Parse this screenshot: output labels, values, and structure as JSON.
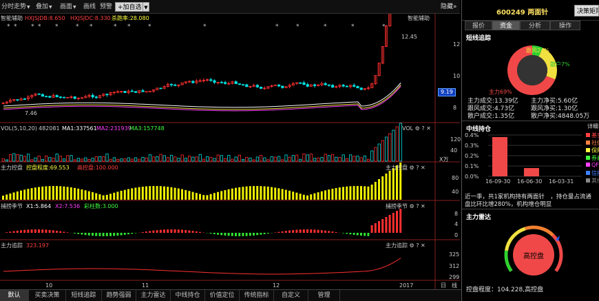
{
  "toolbar": {
    "items": [
      {
        "label": "分时走势",
        "has_arrow": true
      },
      {
        "label": "叠加",
        "has_arrow": true
      },
      {
        "label": "画面",
        "has_arrow": true
      },
      {
        "label": "画线",
        "has_arrow": false
      },
      {
        "label": "预警",
        "has_arrow": false
      },
      {
        "label": "+加自选",
        "has_arrow": false
      }
    ],
    "hide_label": "隐藏",
    "hide_arrow": "»"
  },
  "panels": {
    "main": {
      "title": "智能辅助",
      "title_right": "智能辅助",
      "ind1": "HXJSJDB:8.650",
      "ind2": "HXJSJDC:8.330",
      "ind3": "杀跑率:28.080",
      "price_high": "12.45",
      "price_low": "7.46",
      "current_price": "9.19",
      "axis": [
        "12",
        "10",
        "8"
      ]
    },
    "vol": {
      "title": "VOL(5,10,20)",
      "vol": "482081",
      "ma1": "MA1:337561",
      "ma2": "MA2:231939",
      "ma3": "MA3:157748",
      "title_right": "VOL",
      "axis": [
        "120",
        "40"
      ],
      "unit": "X万"
    },
    "ctrl": {
      "title": "主力控盘",
      "degree": "控盘程度:69.553",
      "high": "高控盘:100.000",
      "title_right": "主力控盘",
      "axis": [
        "80",
        "40"
      ]
    },
    "catch": {
      "title": "捕捞季节",
      "x1": "X1:5.864",
      "x2": "X2:7.536",
      "color": "彩柱数:3.000",
      "title_right": "捕捞季节",
      "axis": [
        "8",
        "4",
        "0"
      ]
    },
    "track": {
      "title": "主力追踪",
      "val": "323.197",
      "title_right": "主力追踪",
      "axis": [
        "325",
        "312",
        "299"
      ]
    },
    "xaxis": [
      "10",
      "11",
      "12",
      "2017"
    ],
    "corner": [
      "日",
      "线"
    ]
  },
  "bottom_tabs": [
    "默认",
    "买卖决策",
    "短线追踪",
    "趋势强弱",
    "主力雷达",
    "中线持仓",
    "价值定位",
    "传统指标",
    "自定义",
    "管理"
  ],
  "right": {
    "code": "600249",
    "name": "两面针",
    "stock_title": "600249 两面针",
    "decision_btn": "决策矩阵",
    "tabs": [
      "报价",
      "资金",
      "分析",
      "操作"
    ],
    "short_track": {
      "title": "短线追踪",
      "pie": {
        "zl": "主力69%",
        "gf": "跟风24%",
        "sh": "散户7%",
        "zl_v": 69,
        "gf_v": 24,
        "sh_v": 7,
        "zl_color": "#f04848",
        "gf_color": "#f0e040",
        "sh_color": "#30d030"
      },
      "rows": [
        [
          "主力成交:13.39亿",
          "主力净买:5.60亿"
        ],
        [
          "跟风成交:4.73亿",
          "跟风净买:1.30亿"
        ],
        [
          "散户成交:1.35亿",
          "散户净买:4848.05万"
        ]
      ]
    },
    "mid_hold": {
      "title": "中线持仓",
      "detail": "详细",
      "yaxis": [
        "0.4%",
        "0.3%",
        "0.2%",
        "0.1%",
        "0.0%"
      ],
      "bars": [
        {
          "date": "16-09-30",
          "value": 0.38
        },
        {
          "date": "16-06-30",
          "value": 0.08
        },
        {
          "date": "16-03-31",
          "value": 0.0
        }
      ],
      "legend": [
        {
          "label": "基金",
          "color": "#ff4040"
        },
        {
          "label": "社保",
          "color": "#ff8040"
        },
        {
          "label": "保险",
          "color": "#ffff40"
        },
        {
          "label": "券商",
          "color": "#40ff40"
        },
        {
          "label": "QFII",
          "color": "#ff40ff"
        },
        {
          "label": "信托",
          "color": "#4080ff"
        },
        {
          "label": "其他",
          "color": "#888888"
        }
      ],
      "text1": "近一季，共1家机构持有两面针　，持仓量占流通",
      "text2": "盘比环比增280%，机构增仓明显"
    },
    "radar": {
      "title": "主力雷达",
      "center": "高控盘",
      "footer": "控盘程度：104.228,高控盘",
      "value": 104.228
    }
  }
}
